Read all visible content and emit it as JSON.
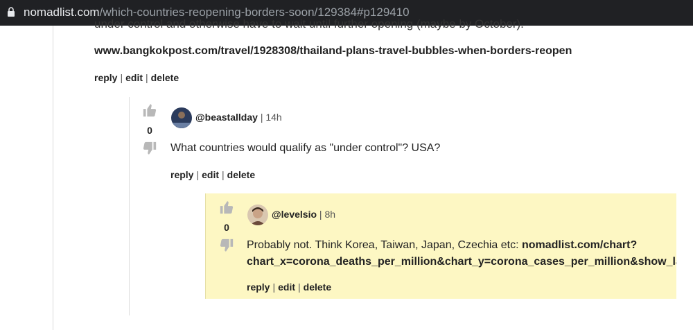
{
  "browser": {
    "url_host": "nomadlist.com",
    "url_path": "/which-countries-reopening-borders-soon/129384#p129410"
  },
  "parent_post": {
    "clipped_text": "under control and otherwise have to wait until further opening (maybe by October).",
    "link_text": "www.bangkokpost.com/travel/1928308/thailand-plans-travel-bubbles-when-borders-reopen",
    "actions": {
      "reply": "reply",
      "edit": "edit",
      "delete": "delete",
      "sep": "|"
    }
  },
  "comment1": {
    "votes": "0",
    "username": "@beastallday",
    "time_sep": "|",
    "time": "14h",
    "text": "What countries would qualify as \"under control\"? USA?",
    "actions": {
      "reply": "reply",
      "edit": "edit",
      "delete": "delete",
      "sep": "|"
    }
  },
  "comment2": {
    "votes": "0",
    "username": "@levelsio",
    "time_sep": "|",
    "time": "8h",
    "text": "Probably not. Think Korea, Taiwan, Japan, Czechia etc: ",
    "link_line1": "nomadlist.com/chart?",
    "link_line2": "chart_x=corona_deaths_per_million&chart_y=corona_cases_per_million&show_labels",
    "actions": {
      "reply": "reply",
      "edit": "edit",
      "delete": "delete",
      "sep": "|"
    }
  },
  "colors": {
    "highlight_bg": "#fdf7c3",
    "address_bar": "#202124"
  },
  "icons": [
    "lock-icon",
    "thumbs-up-icon",
    "thumbs-down-icon"
  ]
}
